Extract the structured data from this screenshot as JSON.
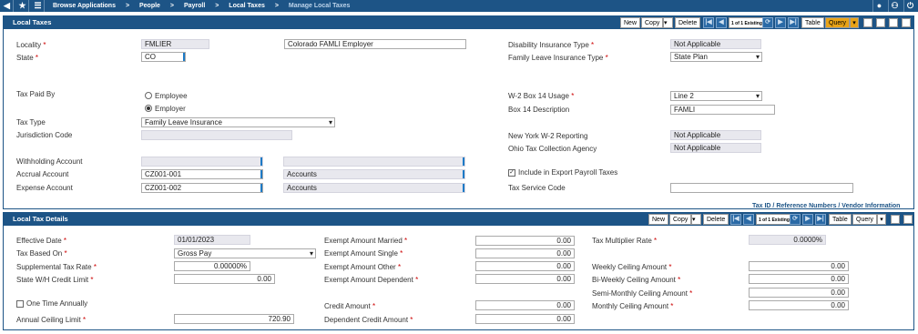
{
  "topbar": {
    "crumbs": [
      "Browse Applications",
      ">",
      "People",
      ">",
      "Payroll",
      ">",
      "Local Taxes",
      ">",
      "Manage Local Taxes"
    ]
  },
  "toolbar": {
    "new": "New",
    "copy": "Copy",
    "delete": "Delete",
    "count": "1 of 1 Existing",
    "table": "Table",
    "query": "Query"
  },
  "local_taxes": {
    "title": "Local Taxes",
    "locality_label": "Locality",
    "locality_value": "FMLIER",
    "locality_desc": "Colorado FAMLI Employer",
    "state_label": "State",
    "state_value": "CO",
    "tax_paid_by_label": "Tax Paid By",
    "employee_label": "Employee",
    "employer_label": "Employer",
    "tax_type_label": "Tax Type",
    "tax_type_value": "Family Leave Insurance",
    "jurisdiction_label": "Jurisdiction Code",
    "withholding_label": "Withholding Account",
    "accrual_label": "Accrual Account",
    "accrual_value": "CZ001-001",
    "accrual_desc": "Accounts",
    "expense_label": "Expense Account",
    "expense_value": "CZ001-002",
    "expense_desc": "Accounts",
    "disability_label": "Disability Insurance Type",
    "disability_value": "Not Applicable",
    "family_leave_label": "Family Leave Insurance Type",
    "family_leave_value": "State Plan",
    "w2_box14_label": "W-2 Box 14 Usage",
    "w2_box14_value": "Line 2",
    "box14_desc_label": "Box 14 Description",
    "box14_desc_value": "FAMLI",
    "ny_w2_label": "New York W-2 Reporting",
    "ny_w2_value": "Not Applicable",
    "ohio_label": "Ohio Tax Collection Agency",
    "ohio_value": "Not Applicable",
    "include_export_label": "Include in Export Payroll Taxes",
    "tax_service_label": "Tax Service Code",
    "tax_id_link": "Tax ID / Reference Numbers / Vendor Information"
  },
  "details": {
    "title": "Local Tax Details",
    "effective_date_label": "Effective Date",
    "effective_date_value": "01/01/2023",
    "tax_based_on_label": "Tax Based On",
    "tax_based_on_value": "Gross Pay",
    "supp_rate_label": "Supplemental Tax Rate",
    "supp_rate_value": "0.00000%",
    "state_wh_label": "State W/H Credit Limit",
    "state_wh_value": "0.00",
    "one_time_label": "One Time Annually",
    "annual_ceiling_label": "Annual Ceiling Limit",
    "annual_ceiling_value": "720.90",
    "exempt_married_label": "Exempt Amount Married",
    "exempt_married_value": "0.00",
    "exempt_single_label": "Exempt Amount Single",
    "exempt_single_value": "0.00",
    "exempt_other_label": "Exempt Amount Other",
    "exempt_other_value": "0.00",
    "exempt_dep_label": "Exempt Amount Dependent",
    "exempt_dep_value": "0.00",
    "credit_amount_label": "Credit Amount",
    "credit_amount_value": "0.00",
    "dep_credit_label": "Dependent Credit Amount",
    "dep_credit_value": "0.00",
    "multiplier_label": "Tax Multiplier Rate",
    "multiplier_value": "0.0000%",
    "weekly_label": "Weekly Ceiling Amount",
    "weekly_value": "0.00",
    "biweekly_label": "Bi-Weekly Ceiling Amount",
    "biweekly_value": "0.00",
    "semimonthly_label": "Semi-Monthly Ceiling Amount",
    "semimonthly_value": "0.00",
    "monthly_label": "Monthly Ceiling Amount",
    "monthly_value": "0.00"
  }
}
